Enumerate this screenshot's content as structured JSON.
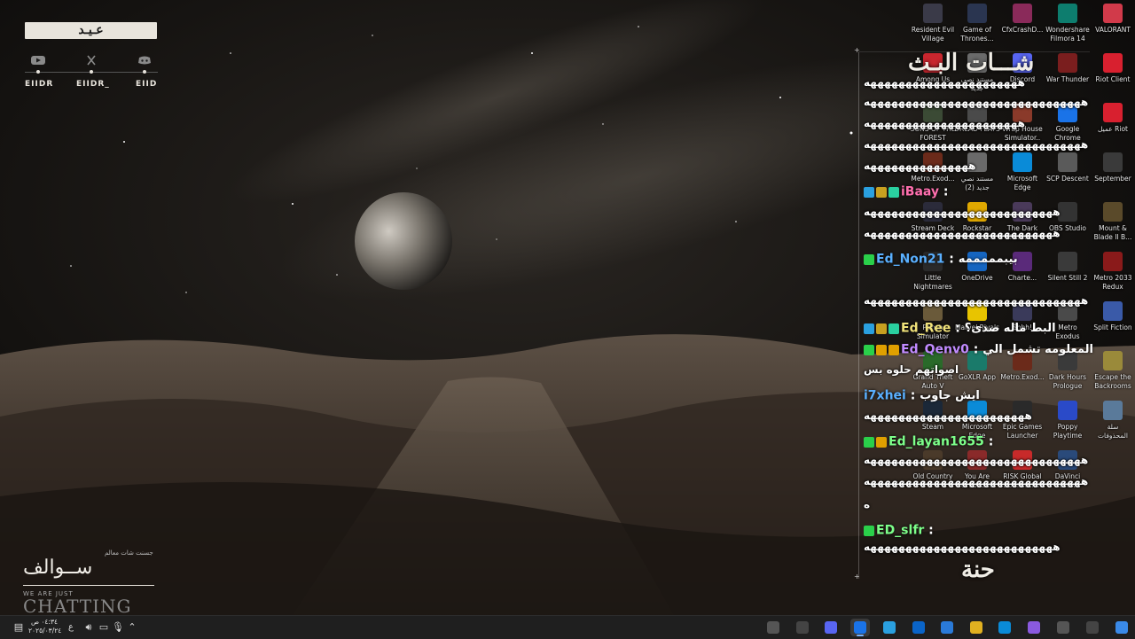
{
  "overlay": {
    "brand_text": "عـيـد",
    "socials": [
      {
        "platform": "youtube",
        "icon": "youtube-icon",
        "handle": "EIIDR"
      },
      {
        "platform": "x",
        "icon": "x-icon",
        "handle": "EIIDR_"
      },
      {
        "platform": "discord",
        "icon": "discord-icon",
        "handle": "EIID"
      }
    ],
    "bottom_left": {
      "subtitle": "جسنت شات معالم",
      "title": "ســوالف",
      "small": "WE ARE JUST",
      "big": "CHATTING"
    }
  },
  "desktop_icons": [
    {
      "label": "Resident Evil\nVillage",
      "icon": "resident-evil-icon",
      "color": "#3a3a48"
    },
    {
      "label": "Game of\nThrones...",
      "icon": "game-of-thrones-icon",
      "color": "#2a3550"
    },
    {
      "label": "CfxCrashD...",
      "icon": "winrar-icon",
      "color": "#8a2a5a"
    },
    {
      "label": "Wondershare\nFilmora 14",
      "icon": "filmora-icon",
      "color": "#0d7d6e"
    },
    {
      "label": "VALORANT",
      "icon": "valorant-icon",
      "color": "#d13a4a"
    },
    {
      "label": "Among Us",
      "icon": "among-us-icon",
      "color": "#c8262e"
    },
    {
      "label": "مستند نصي\nجديد",
      "icon": "text-document-icon",
      "color": "#6a6a6a"
    },
    {
      "label": "Discord",
      "icon": "discord-icon",
      "color": "#5865f2"
    },
    {
      "label": "War Thunder",
      "icon": "war-thunder-icon",
      "color": "#7a1e1e"
    },
    {
      "label": "Riot Client",
      "icon": "riot-client-icon",
      "color": "#d8202f"
    },
    {
      "label": "SONS OF THE\nFOREST",
      "icon": "sons-of-the-forest-icon",
      "color": "#3b4a35"
    },
    {
      "label": "DREAD FLATS",
      "icon": "dread-flats-icon",
      "color": "#4a4a4a"
    },
    {
      "label": "Wrap House\nSimulator..",
      "icon": "wrap-house-icon",
      "color": "#8a3a2a"
    },
    {
      "label": "Google\nChrome",
      "icon": "chrome-icon",
      "color": "#1a73e8"
    },
    {
      "label": "عميل Riot",
      "icon": "riot-icon",
      "color": "#d8202f"
    },
    {
      "label": "Metro.Exod...",
      "icon": "metro-exodus-icon",
      "color": "#6b2a1a"
    },
    {
      "label": "مستند نصي\n(2) جديد",
      "icon": "text-document-icon",
      "color": "#6a6a6a"
    },
    {
      "label": "Microsoft\nEdge",
      "icon": "edge-icon",
      "color": "#0a8bd8"
    },
    {
      "label": "SCP Descent",
      "icon": "scp-descent-icon",
      "color": "#5a5a5a"
    },
    {
      "label": "September",
      "icon": "september-icon",
      "color": "#3a3a3a"
    },
    {
      "label": "Stream Deck",
      "icon": "stream-deck-icon",
      "color": "#2b2b3a"
    },
    {
      "label": "Rockstar\nGames ...",
      "icon": "rockstar-icon",
      "color": "#e0a800"
    },
    {
      "label": "The Dark\nPursuer",
      "icon": "dark-pursuer-icon",
      "color": "#4a3a5a"
    },
    {
      "label": "OBS Studio",
      "icon": "obs-icon",
      "color": "#333333"
    },
    {
      "label": "Mount &\nBlade II B...",
      "icon": "mount-blade-icon",
      "color": "#5a4a2a"
    },
    {
      "label": "Little\nNightmares",
      "icon": "little-nightmares-icon",
      "color": "#2a2a2a"
    },
    {
      "label": "OneDrive",
      "icon": "onedrive-icon",
      "color": "#1565c0"
    },
    {
      "label": "Charte...",
      "icon": "chart-icon",
      "color": "#5a2a7a"
    },
    {
      "label": "Silent Still 2",
      "icon": "silent-still-icon",
      "color": "#3a3a3a"
    },
    {
      "label": "Metro 2033\nRedux",
      "icon": "metro-2033-icon",
      "color": "#8a1a1a"
    },
    {
      "label": "Ranch\nSimulator",
      "icon": "ranch-simulator-icon",
      "color": "#6a5a3a"
    },
    {
      "label": "Marvel Rivals",
      "icon": "marvel-rivals-icon",
      "color": "#e8c400"
    },
    {
      "label": "Shhh!",
      "icon": "shhh-icon",
      "color": "#3a3a5a"
    },
    {
      "label": "Metro\nExodus",
      "icon": "metro-exodus-icon",
      "color": "#4a4a4a"
    },
    {
      "label": "Split Fiction",
      "icon": "split-fiction-icon",
      "color": "#3a5aa8"
    },
    {
      "label": "Grand Theft\nAuto V",
      "icon": "gta-v-icon",
      "color": "#2a6a2a"
    },
    {
      "label": "GoXLR App",
      "icon": "goxlr-icon",
      "color": "#1a7a6a"
    },
    {
      "label": "Metro.Exod...",
      "icon": "metro-exodus-icon",
      "color": "#6b2a1a"
    },
    {
      "label": "Dark Hours\nPrologue",
      "icon": "dark-hours-icon",
      "color": "#3a3a3a"
    },
    {
      "label": "Escape the\nBackrooms",
      "icon": "escape-backrooms-icon",
      "color": "#9a8a3a"
    },
    {
      "label": "Steam",
      "icon": "steam-icon",
      "color": "#1b2838"
    },
    {
      "label": "Microsoft\nEdge",
      "icon": "edge-icon",
      "color": "#0a8bd8"
    },
    {
      "label": "Epic Games\nLauncher",
      "icon": "epic-games-icon",
      "color": "#2a2a2a"
    },
    {
      "label": "Poppy\nPlaytime",
      "icon": "poppy-playtime-icon",
      "color": "#2a4ac8"
    },
    {
      "label": "سلة\nالمحذوفات",
      "icon": "recycle-bin-icon",
      "color": "#5a7a9a"
    },
    {
      "label": "Old Country",
      "icon": "old-country-icon",
      "color": "#4a3a2a"
    },
    {
      "label": "You Are\nGrounded",
      "icon": "you-are-grounded-icon",
      "color": "#8a2a2a"
    },
    {
      "label": "RISK Global\nDomination",
      "icon": "risk-icon",
      "color": "#c82a2a"
    },
    {
      "label": "DaVinci\nResolve",
      "icon": "davinci-icon",
      "color": "#2a4a7a"
    }
  ],
  "chat": {
    "title": "شـــات البـث",
    "lines": [
      {
        "type": "msg",
        "text": "ههههههههههههههههههههههه"
      },
      {
        "type": "msg",
        "text": "هههههههههههههههههههههههههههههههه"
      },
      {
        "type": "msg",
        "text": "ههههههههههههههههههههههه"
      },
      {
        "type": "msg",
        "text": "هههههههههههههههههههههههههههههههه"
      },
      {
        "type": "msg",
        "text": "هههههههههههههههه"
      },
      {
        "type": "user",
        "name": "iBaay",
        "color": "#ff6fae",
        "badges": [
          "#2aa0e0",
          "#c8a020",
          "#2ad0a0"
        ],
        "text": ""
      },
      {
        "type": "msg",
        "text": "هههههههههههههههههههههههههههه"
      },
      {
        "type": "msg",
        "text": "هههههههههههههههههههههههههههه"
      },
      {
        "type": "user",
        "name": "Ed_Non21",
        "color": "#5ab0ff",
        "badges": [
          "#2ad04a"
        ],
        "text": "بيبمممممه"
      },
      {
        "type": "msg",
        "text": "هههههههههههههههههههههههههههههههه"
      },
      {
        "type": "user",
        "name": "Ed_Ree",
        "color": "#f0e27a",
        "badges": [
          "#2aa0e0",
          "#c8a020",
          "#2ad0a0"
        ],
        "text": "البط ماله صدى؟"
      },
      {
        "type": "user",
        "name": "Ed_Qenv0",
        "color": "#c18bff",
        "badges": [
          "#2ad04a",
          "#e0a000",
          "#e0a000"
        ],
        "text": "المعلومه تشمل الي"
      },
      {
        "type": "msg",
        "text": "اصواتهم حلوه بس"
      },
      {
        "type": "user",
        "name": "i7xhei",
        "color": "#5ab0ff",
        "badges": [],
        "text": "ايش جاوب"
      },
      {
        "type": "msg",
        "text": "هههههههههههههههههههههههه"
      },
      {
        "type": "user",
        "name": "Ed_layan1655",
        "color": "#7dff8a",
        "badges": [
          "#2ad04a",
          "#e0a000"
        ],
        "text": ""
      },
      {
        "type": "msg",
        "text": "هههههههههههههههههههههههههههههههه"
      },
      {
        "type": "msg",
        "text": "هههههههههههههههههههههههههههههههه"
      },
      {
        "type": "msg",
        "text": "ه"
      },
      {
        "type": "user",
        "name": "ED_slfr",
        "color": "#7dff8a",
        "badges": [
          "#2ad04a"
        ],
        "text": ""
      },
      {
        "type": "msg",
        "text": "هههههههههههههههههههههههههههه"
      },
      {
        "type": "msg",
        "text": "هههههههههههههههههههههههههههههههه"
      }
    ],
    "footer_logo": "حنة"
  },
  "taskbar": {
    "clock_time": "٠٤:٣٤ ص",
    "clock_date": "٢٠٢٥/٠٣/٢٤",
    "lang": "ع",
    "apps": [
      {
        "icon": "window-close-icon",
        "color": "#555555",
        "active": false
      },
      {
        "icon": "obs-icon",
        "color": "#444444",
        "active": false
      },
      {
        "icon": "discord-icon",
        "color": "#5865f2",
        "active": false
      },
      {
        "icon": "chrome-icon",
        "color": "#1a73e8",
        "active": true
      },
      {
        "icon": "telegram-icon",
        "color": "#2aa0e0",
        "active": false
      },
      {
        "icon": "outlook-icon",
        "color": "#0a64c8",
        "active": false
      },
      {
        "icon": "store-icon",
        "color": "#2a7ad8",
        "active": false
      },
      {
        "icon": "file-explorer-icon",
        "color": "#e0b020",
        "active": false
      },
      {
        "icon": "edge-icon",
        "color": "#0a8bd8",
        "active": false
      },
      {
        "icon": "copilot-icon",
        "color": "#8a5ae0",
        "active": false
      },
      {
        "icon": "task-view-icon",
        "color": "#555555",
        "active": false
      },
      {
        "icon": "search-icon",
        "color": "#444444",
        "active": false
      },
      {
        "icon": "start-icon",
        "color": "#3a8ae8",
        "active": false
      }
    ]
  }
}
